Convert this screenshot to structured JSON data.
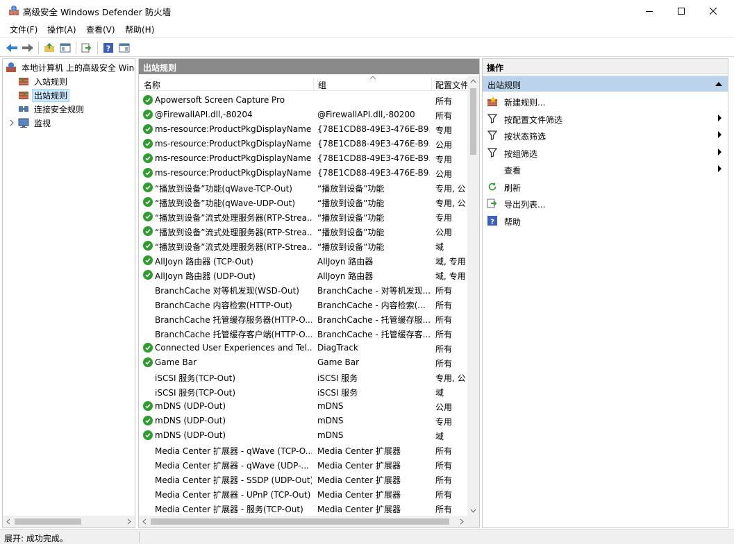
{
  "window": {
    "title": "高级安全 Windows Defender 防火墙"
  },
  "menu": [
    "文件(F)",
    "操作(A)",
    "查看(V)",
    "帮助(H)"
  ],
  "toolbar": {
    "icons": [
      "back-arrow-icon",
      "forward-arrow-icon",
      "up-folder-icon",
      "show-hide-tree-icon",
      "export-icon",
      "help-icon",
      "properties-icon"
    ]
  },
  "tree": [
    {
      "label": "本地计算机 上的高级安全 Windows Defender 防火墙",
      "icon": "firewall-icon",
      "indent": 0
    },
    {
      "label": "入站规则",
      "icon": "inbound-rules-icon",
      "indent": 1
    },
    {
      "label": "出站规则",
      "icon": "outbound-rules-icon",
      "indent": 1,
      "selected": true
    },
    {
      "label": "连接安全规则",
      "icon": "connection-security-icon",
      "indent": 1
    },
    {
      "label": "监视",
      "icon": "monitor-icon",
      "indent": 1,
      "expandable": true
    }
  ],
  "center": {
    "title": "出站规则",
    "columns": [
      "名称",
      "组",
      "配置文件"
    ],
    "rows": [
      {
        "enabled": true,
        "name": "Apowersoft Screen Capture Pro",
        "group": "",
        "profile": "所有"
      },
      {
        "enabled": true,
        "name": "@FirewallAPI.dll,-80204",
        "group": "@FirewallAPI.dll,-80200",
        "profile": "所有"
      },
      {
        "enabled": true,
        "name": "ms-resource:ProductPkgDisplayName",
        "group": "{78E1CD88-49E3-476E-B9...",
        "profile": "专用"
      },
      {
        "enabled": true,
        "name": "ms-resource:ProductPkgDisplayName",
        "group": "{78E1CD88-49E3-476E-B9...",
        "profile": "公用"
      },
      {
        "enabled": true,
        "name": "ms-resource:ProductPkgDisplayName",
        "group": "{78E1CD88-49E3-476E-B9...",
        "profile": "专用"
      },
      {
        "enabled": true,
        "name": "ms-resource:ProductPkgDisplayName",
        "group": "{78E1CD88-49E3-476E-B9...",
        "profile": "公用"
      },
      {
        "enabled": true,
        "name": "“播放到设备”功能(qWave-TCP-Out)",
        "group": "“播放到设备”功能",
        "profile": "专用, 公"
      },
      {
        "enabled": true,
        "name": "“播放到设备”功能(qWave-UDP-Out)",
        "group": "“播放到设备”功能",
        "profile": "专用, 公"
      },
      {
        "enabled": true,
        "name": "“播放到设备”流式处理服务器(RTP-Strea...",
        "group": "“播放到设备”功能",
        "profile": "专用"
      },
      {
        "enabled": true,
        "name": "“播放到设备”流式处理服务器(RTP-Strea...",
        "group": "“播放到设备”功能",
        "profile": "公用"
      },
      {
        "enabled": true,
        "name": "“播放到设备”流式处理服务器(RTP-Strea...",
        "group": "“播放到设备”功能",
        "profile": "域"
      },
      {
        "enabled": true,
        "name": "AllJoyn 路由器 (TCP-Out)",
        "group": "AllJoyn 路由器",
        "profile": "域, 专用"
      },
      {
        "enabled": true,
        "name": "AllJoyn 路由器 (UDP-Out)",
        "group": "AllJoyn 路由器",
        "profile": "域, 专用"
      },
      {
        "enabled": false,
        "name": "BranchCache 对等机发现(WSD-Out)",
        "group": "BranchCache - 对等机发现...",
        "profile": "所有"
      },
      {
        "enabled": false,
        "name": "BranchCache 内容检索(HTTP-Out)",
        "group": "BranchCache - 内容检索(...",
        "profile": "所有"
      },
      {
        "enabled": false,
        "name": "BranchCache 托管缓存服务器(HTTP-O...",
        "group": "BranchCache - 托管缓存服...",
        "profile": "所有"
      },
      {
        "enabled": false,
        "name": "BranchCache 托管缓存客户端(HTTP-O...",
        "group": "BranchCache - 托管缓存客...",
        "profile": "所有"
      },
      {
        "enabled": true,
        "name": "Connected User Experiences and Tel...",
        "group": "DiagTrack",
        "profile": "所有"
      },
      {
        "enabled": true,
        "name": "Game Bar",
        "group": "Game Bar",
        "profile": "所有"
      },
      {
        "enabled": false,
        "name": "iSCSI 服务(TCP-Out)",
        "group": "iSCSI 服务",
        "profile": "专用, 公"
      },
      {
        "enabled": false,
        "name": "iSCSI 服务(TCP-Out)",
        "group": "iSCSI 服务",
        "profile": "域"
      },
      {
        "enabled": true,
        "name": "mDNS (UDP-Out)",
        "group": "mDNS",
        "profile": "公用"
      },
      {
        "enabled": true,
        "name": "mDNS (UDP-Out)",
        "group": "mDNS",
        "profile": "专用"
      },
      {
        "enabled": true,
        "name": "mDNS (UDP-Out)",
        "group": "mDNS",
        "profile": "域"
      },
      {
        "enabled": false,
        "name": "Media Center 扩展器 - qWave (TCP-O...",
        "group": "Media Center 扩展器",
        "profile": "所有"
      },
      {
        "enabled": false,
        "name": "Media Center 扩展器 - qWave (UDP-...",
        "group": "Media Center 扩展器",
        "profile": "所有"
      },
      {
        "enabled": false,
        "name": "Media Center 扩展器 - SSDP (UDP-Out)",
        "group": "Media Center 扩展器",
        "profile": "所有"
      },
      {
        "enabled": false,
        "name": "Media Center 扩展器 - UPnP (TCP-Out)",
        "group": "Media Center 扩展器",
        "profile": "所有"
      },
      {
        "enabled": false,
        "name": "Media Center 扩展器 - 服务(TCP-Out)",
        "group": "Media Center 扩展器",
        "profile": "所有"
      }
    ]
  },
  "actions": {
    "title": "操作",
    "section": "出站规则",
    "items": [
      {
        "label": "新建规则...",
        "icon": "new-rule-icon",
        "submenu": false
      },
      {
        "label": "按配置文件筛选",
        "icon": "filter-icon",
        "submenu": true
      },
      {
        "label": "按状态筛选",
        "icon": "filter-icon",
        "submenu": true
      },
      {
        "label": "按组筛选",
        "icon": "filter-icon",
        "submenu": true
      },
      {
        "label": "查看",
        "icon": "",
        "submenu": true
      },
      {
        "label": "刷新",
        "icon": "refresh-icon",
        "submenu": false
      },
      {
        "label": "导出列表...",
        "icon": "export-list-icon",
        "submenu": false
      },
      {
        "label": "帮助",
        "icon": "help-icon",
        "submenu": false
      }
    ]
  },
  "status": {
    "text": "展开: 成功完成。"
  },
  "colors": {
    "accent_selection": "#cce8ff",
    "pane_header": "#8a8a8a",
    "actions_section": "#bcd4eb",
    "enabled_check": "#2e9c2e"
  }
}
